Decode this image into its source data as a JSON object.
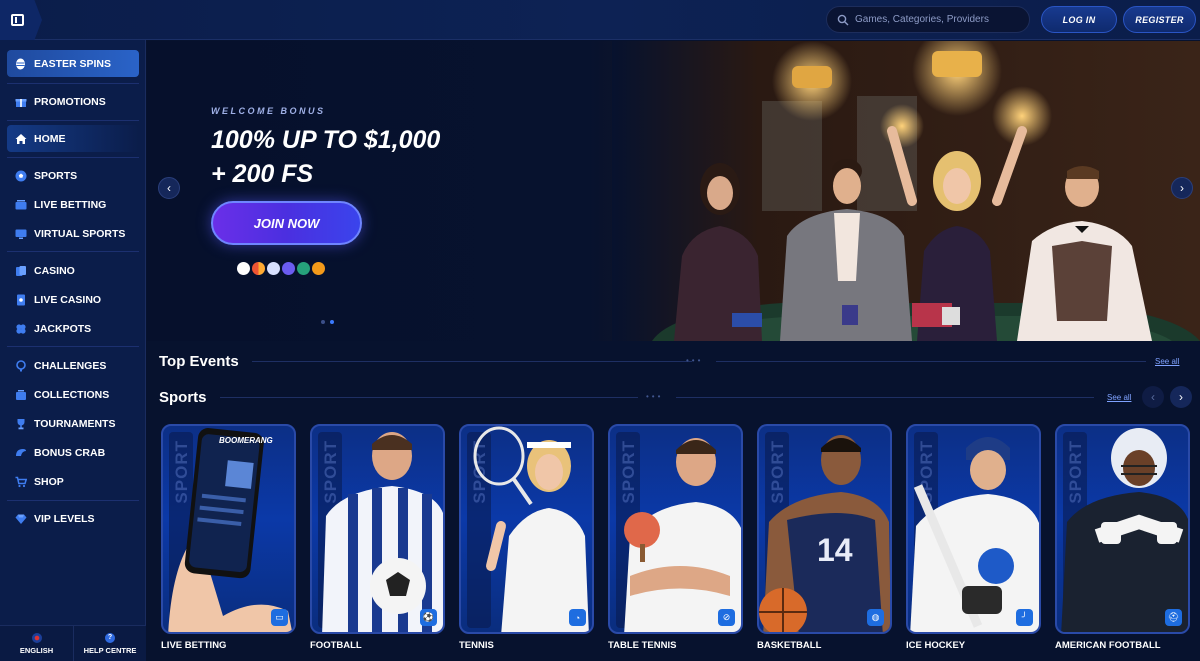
{
  "header": {
    "search_placeholder": "Games, Categories, Providers",
    "login": "LOG IN",
    "register": "REGISTER"
  },
  "sidebar": {
    "items": [
      {
        "label": "EASTER SPINS",
        "icon": "egg-icon"
      },
      {
        "label": "PROMOTIONS",
        "icon": "gift-icon"
      },
      {
        "label": "HOME",
        "icon": "home-icon"
      },
      {
        "label": "SPORTS",
        "icon": "soccer-ball-icon"
      },
      {
        "label": "LIVE BETTING",
        "icon": "live-icon"
      },
      {
        "label": "VIRTUAL SPORTS",
        "icon": "monitor-icon"
      },
      {
        "label": "CASINO",
        "icon": "cards-icon"
      },
      {
        "label": "LIVE CASINO",
        "icon": "dealer-icon"
      },
      {
        "label": "JACKPOTS",
        "icon": "clover-icon"
      },
      {
        "label": "CHALLENGES",
        "icon": "target-icon"
      },
      {
        "label": "COLLECTIONS",
        "icon": "collection-icon"
      },
      {
        "label": "TOURNAMENTS",
        "icon": "trophy-icon"
      },
      {
        "label": "BONUS CRAB",
        "icon": "crab-icon"
      },
      {
        "label": "SHOP",
        "icon": "cart-icon"
      },
      {
        "label": "VIP LEVELS",
        "icon": "diamond-icon"
      }
    ],
    "footer": {
      "language": "ENGLISH",
      "help": "HELP CENTRE"
    }
  },
  "hero": {
    "eyebrow": "WELCOME BONUS",
    "line1": "100% UP TO $1,000",
    "line2": "+ 200 FS",
    "cta": "JOIN NOW",
    "payment_icons": [
      "visa-icon",
      "mastercard-icon",
      "bank-icon",
      "ethereum-icon",
      "tether-icon",
      "bitcoin-icon"
    ]
  },
  "top_events": {
    "title": "Top Events",
    "see_all": "See all"
  },
  "sports": {
    "title": "Sports",
    "see_all": "See all",
    "cards": [
      {
        "label": "LIVE BETTING",
        "badge": "live-icon"
      },
      {
        "label": "FOOTBALL",
        "badge": "soccer-ball-icon"
      },
      {
        "label": "TENNIS",
        "badge": "tennis-ball-icon"
      },
      {
        "label": "TABLE TENNIS",
        "badge": "paddle-icon"
      },
      {
        "label": "BASKETBALL",
        "badge": "basketball-icon"
      },
      {
        "label": "ICE HOCKEY",
        "badge": "hockey-stick-icon"
      },
      {
        "label": "AMERICAN FOOTBALL",
        "badge": "helmet-icon"
      }
    ],
    "card_word": "SPORT",
    "jersey_number": "14",
    "phone_brand": "BOOMERANG"
  },
  "colors": {
    "accent": "#2a63c8",
    "cta": "#5a33e6",
    "bg": "#07122e"
  }
}
